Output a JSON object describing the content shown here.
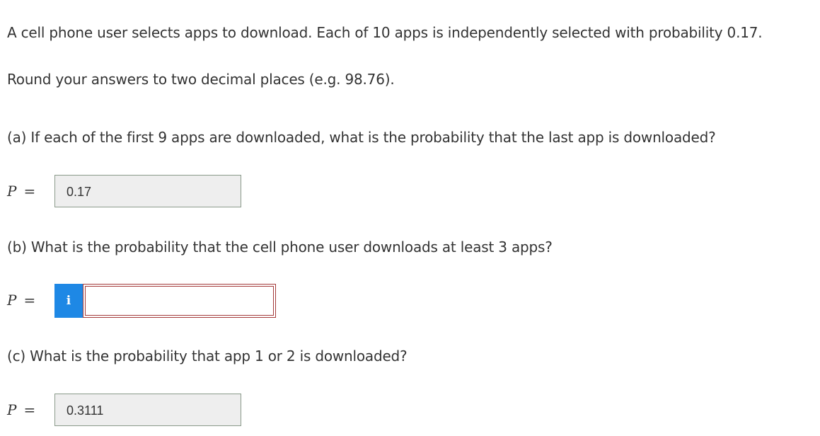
{
  "problem": {
    "statement": "A cell phone user selects apps to download. Each of 10 apps is independently selected with probability 0.17.",
    "instructions": "Round your answers to two decimal places (e.g. 98.76)."
  },
  "parts": [
    {
      "question": "(a) If each of the first 9 apps are downloaded, what is the probability that the last app is downloaded?",
      "var": "P",
      "eq": "=",
      "answer": "0.17"
    },
    {
      "question": "(b) What is the probability that the cell phone user downloads at least 3 apps?",
      "var": "P",
      "eq": "=",
      "info_glyph": "i",
      "answer": "",
      "placeholder": ""
    },
    {
      "question": "(c) What is the probability that app 1 or 2 is downloaded?",
      "var": "P",
      "eq": "=",
      "answer": "0.3111"
    }
  ],
  "colors": {
    "text": "#333333",
    "info_button": "#1e88e5",
    "invalid_border": "#a33a3a",
    "readonly_fill": "#eeeeee"
  }
}
